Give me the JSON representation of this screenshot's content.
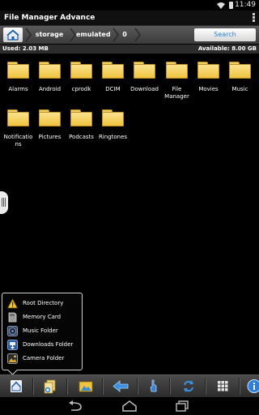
{
  "status": {
    "time": "11:49"
  },
  "app": {
    "title": "File Manager Advance"
  },
  "path": {
    "crumbs": [
      "storage",
      "emulated",
      "0"
    ],
    "search_label": "Search"
  },
  "storage": {
    "used": "Used: 2.03 MB",
    "available": "Available: 8.00 GB"
  },
  "folders": [
    {
      "label": "Alarms"
    },
    {
      "label": "Android"
    },
    {
      "label": "cprodk"
    },
    {
      "label": "DCIM"
    },
    {
      "label": "Download"
    },
    {
      "label": "File Manager"
    },
    {
      "label": "Movies"
    },
    {
      "label": "Music"
    },
    {
      "label": "Notificatio ns"
    },
    {
      "label": "Pictures"
    },
    {
      "label": "Podcasts"
    },
    {
      "label": "Ringtones"
    }
  ],
  "popup": {
    "items": [
      {
        "label": "Root Directory",
        "icon": "warning-icon"
      },
      {
        "label": "Memory Card",
        "icon": "memory-card-icon"
      },
      {
        "label": "Music Folder",
        "icon": "music-folder-icon"
      },
      {
        "label": "Downloads Folder",
        "icon": "downloads-folder-icon"
      },
      {
        "label": "Camera Folder",
        "icon": "camera-folder-icon"
      }
    ]
  },
  "toolbar": {
    "buttons": [
      "home-icon",
      "new-item-icon",
      "gallery-icon",
      "back-icon",
      "multi-select-icon",
      "refresh-icon",
      "grid-view-icon",
      "info-icon"
    ]
  },
  "colors": {
    "accent": "#2a7fd4",
    "folder": "#efc340",
    "background": "#000000"
  }
}
